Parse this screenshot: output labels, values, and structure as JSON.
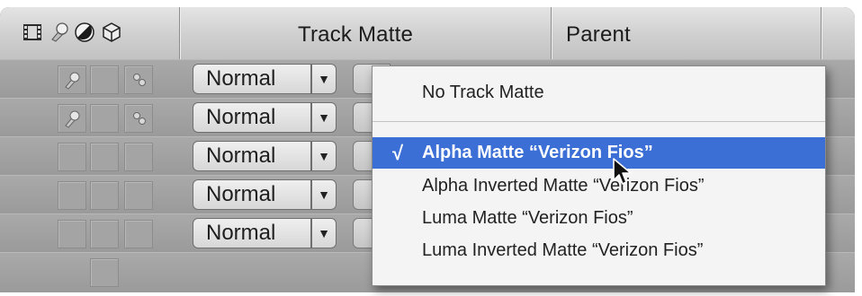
{
  "header": {
    "track_matte_label": "Track Matte",
    "parent_label": "Parent",
    "icons": [
      "film-icon",
      "shy-icon",
      "motion-blur-icon",
      "3d-cube-icon"
    ]
  },
  "layers": [
    {
      "mode": "Normal",
      "switches": [
        "shy",
        "",
        "fx"
      ]
    },
    {
      "mode": "Normal",
      "switches": [
        "shy",
        "",
        "fx"
      ]
    },
    {
      "mode": "Normal",
      "switches": [
        "",
        "",
        ""
      ]
    },
    {
      "mode": "Normal",
      "switches": [
        "",
        "",
        ""
      ]
    },
    {
      "mode": "Normal",
      "switches": [
        "",
        "",
        ""
      ]
    }
  ],
  "menu": {
    "items": [
      {
        "label": "No Track Matte",
        "selected": false
      },
      {
        "label": "Alpha Matte “Verizon Fios”",
        "selected": true
      },
      {
        "label": "Alpha Inverted Matte “Verizon Fios”",
        "selected": false
      },
      {
        "label": "Luma Matte “Verizon Fios”",
        "selected": false
      },
      {
        "label": "Luma Inverted Matte “Verizon Fios”",
        "selected": false
      }
    ],
    "check_mark": "√",
    "dropdown_arrow": "▼"
  }
}
